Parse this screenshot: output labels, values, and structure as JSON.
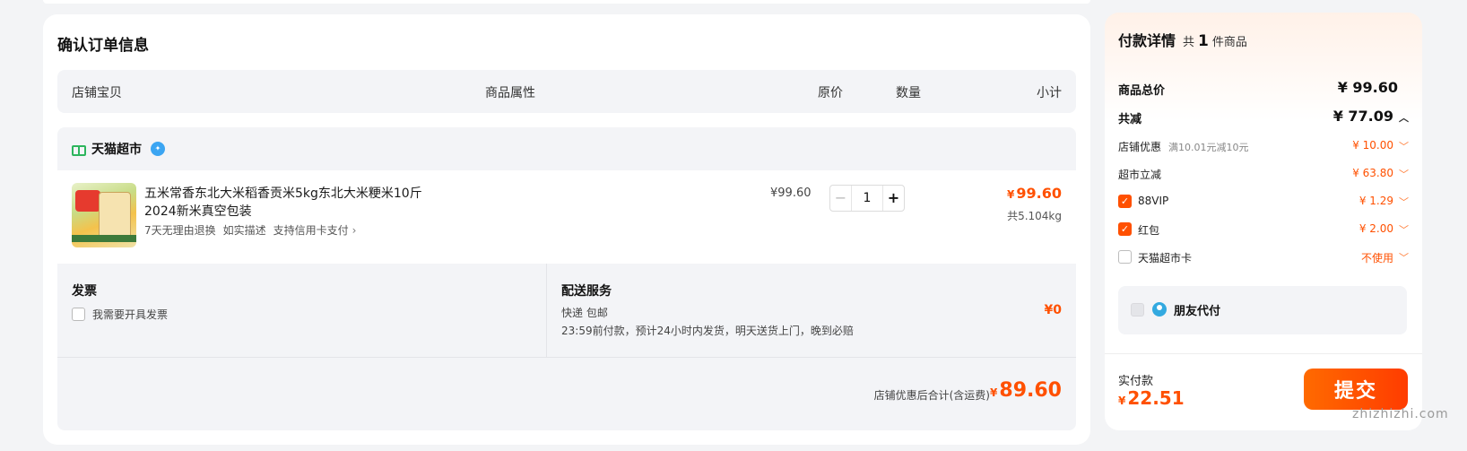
{
  "order": {
    "title": "确认订单信息",
    "columns": {
      "shop_item": "店铺宝贝",
      "attributes": "商品属性",
      "orig_price": "原价",
      "quantity": "数量",
      "subtotal": "小计"
    },
    "shop": {
      "name": "天猫超市"
    },
    "item": {
      "title": "五米常香东北大米稻香贡米5kg东北大米粳米10斤2024新米真空包装",
      "tags": [
        "7天无理由退换",
        "如实描述",
        "支持信用卡支付"
      ],
      "orig_price": "¥99.60",
      "quantity": "1",
      "subtotal": "99.60",
      "weight": "共5.104kg"
    },
    "invoice": {
      "title": "发票",
      "checkbox_label": "我需要开具发票"
    },
    "delivery": {
      "title": "配送服务",
      "method": "快递 包邮",
      "desc": "23:59前付款，预计24小时内发货，明天送货上门，晚到必赔",
      "fee": "¥0"
    },
    "shop_total": {
      "label": "店铺优惠后合计(含运费)",
      "value": "89.60"
    }
  },
  "payment": {
    "title": "付款详情",
    "count_prefix": "共",
    "count": "1",
    "count_suffix": "件商品",
    "total": {
      "label": "商品总价",
      "value": "¥ 99.60"
    },
    "discount": {
      "label": "共减",
      "value": "¥ 77.09"
    },
    "shop_discount": {
      "label": "店铺优惠",
      "note": "满10.01元减10元",
      "value": "¥ 10.00"
    },
    "market_cut": {
      "label": "超市立减",
      "value": "¥ 63.80"
    },
    "vip": {
      "label": "88VIP",
      "value": "¥ 1.29",
      "checked": true
    },
    "redpacket": {
      "label": "红包",
      "value": "¥ 2.00",
      "checked": true
    },
    "market_card": {
      "label": "天猫超市卡",
      "value": "不使用",
      "checked": false
    },
    "friend_pay": {
      "label": "朋友代付"
    },
    "actual": {
      "label": "实付款",
      "value": "22.51"
    },
    "submit_label": "提交"
  },
  "watermark": "zhizhizhi.com",
  "colors": {
    "accent": "#ff5000",
    "panel_bg": "#f3f4f7",
    "page_bg": "#f3f4f6"
  }
}
